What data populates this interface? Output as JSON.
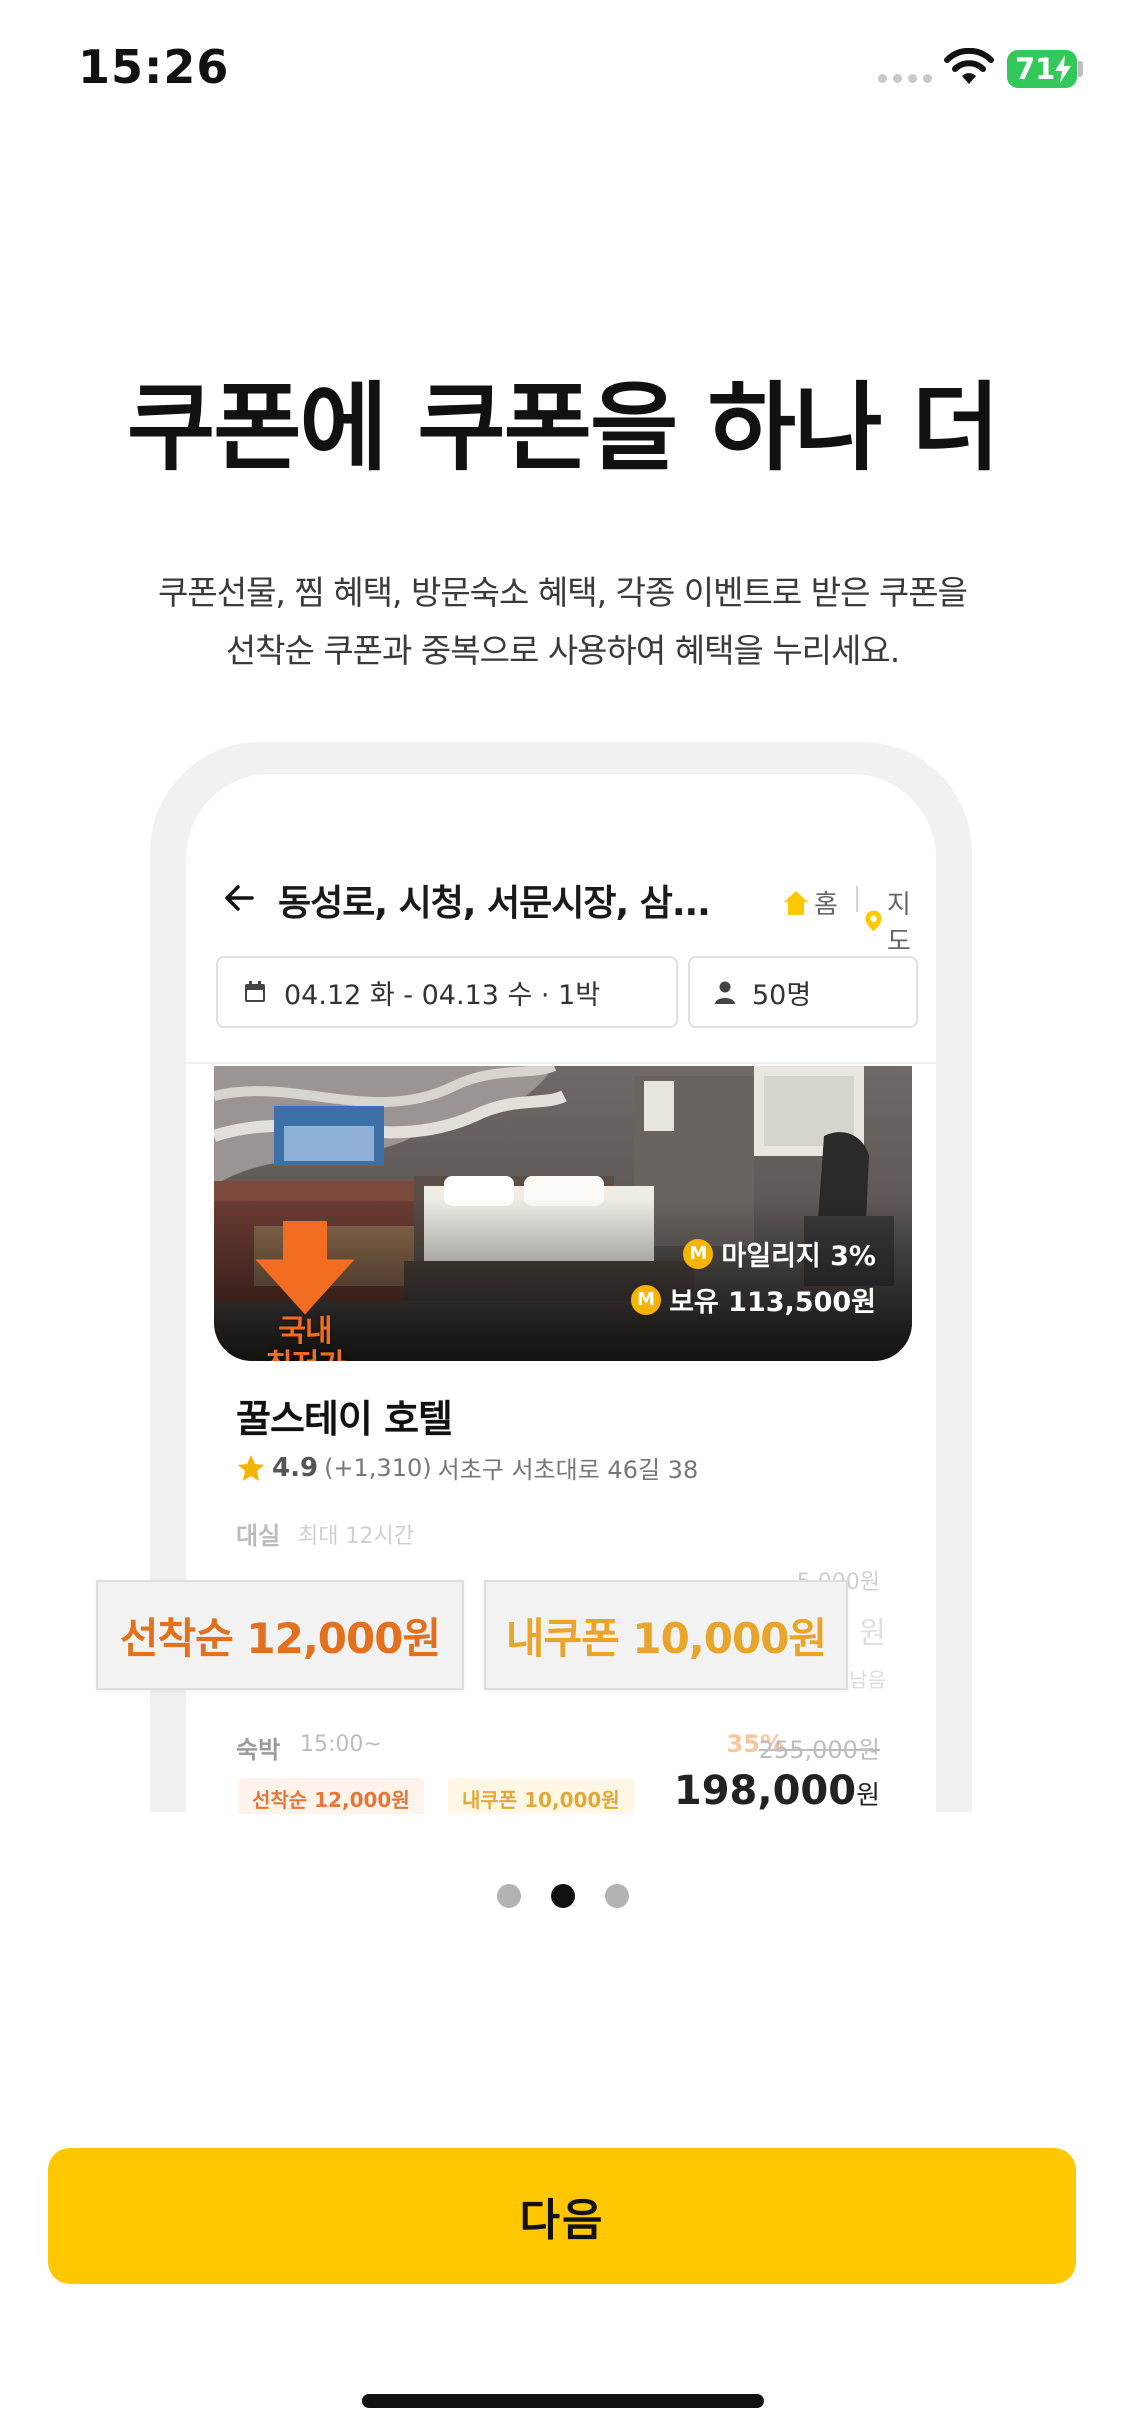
{
  "status_bar": {
    "time": "15:26",
    "battery": "71"
  },
  "onboarding": {
    "title": "쿠폰에 쿠폰을 하나 더",
    "description_line1": "쿠폰선물, 찜 혜택, 방문숙소 혜택, 각종 이벤트로 받은 쿠폰을",
    "description_line2": "선착순 쿠폰과 중복으로 사용하여 혜택을 누리세요."
  },
  "preview": {
    "header_title": "동성로, 시청, 서문시장, 삼...",
    "home_label": "홈",
    "map_label": "지도",
    "date_range": "04.12 화 - 04.13 수 · 1박",
    "guests": "50명",
    "lowest_badge_line1": "국내",
    "lowest_badge_line2": "최저가",
    "mileage": "마일리지 3%",
    "owned": "보유 113,500원",
    "coin_letter": "M",
    "hotel_name": "꿀스테이 호텔",
    "rating": "4.9",
    "review_count": "(+1,310)",
    "address": "서초구 서초대로 46길 38",
    "dayuse_label": "대실",
    "dayuse_sub": "최대 12시간",
    "dayuse_price": "5,000원",
    "dayuse_price2": "원",
    "dayuse_note": "남음",
    "stay_label": "숙박",
    "stay_time": "15:00~",
    "discount": "35%",
    "original_price": "255,000원",
    "chip_first": "선착순 12,000원",
    "chip_mine": "내쿠폰 10,000원",
    "final_price": "198,000",
    "won": "원"
  },
  "coupons": {
    "first_come": "선착순 12,000원",
    "my_coupon": "내쿠폰 10,000원"
  },
  "pager": {
    "total": 3,
    "active_index": 1
  },
  "actions": {
    "next_label": "다음"
  },
  "colors": {
    "accent": "#ffc700",
    "coupon_orange": "#e2711f",
    "coupon_yellow": "#e8a52b"
  }
}
